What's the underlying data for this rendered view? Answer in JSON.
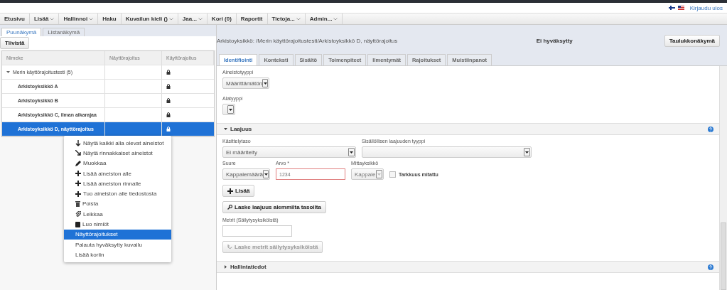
{
  "header": {
    "link": "Kirjaudu ulos"
  },
  "menu_bar": [
    {
      "label": "Etusivu",
      "dropdown": false
    },
    {
      "label": "Lisää",
      "dropdown": true
    },
    {
      "label": "Hallinnoi",
      "dropdown": true
    },
    {
      "label": "Haku",
      "dropdown": false
    },
    {
      "label": "Kuvailun kieli ()",
      "dropdown": true
    },
    {
      "label": "Jaa...",
      "dropdown": true
    },
    {
      "label": "Kori (0)",
      "dropdown": false
    },
    {
      "label": "Raportit",
      "dropdown": false
    },
    {
      "label": "Tietoja...",
      "dropdown": true
    },
    {
      "label": "Admin...",
      "dropdown": true
    }
  ],
  "left_tabs": [
    {
      "label": "Puunäkymä",
      "selected": true
    },
    {
      "label": "Listanäkymä",
      "selected": false
    }
  ],
  "collapse_button": "Tiivistä",
  "tree_table": {
    "columns": [
      "Nimeke",
      "Näyttörajoitus",
      "Käyttörajoitus"
    ],
    "rows": [
      {
        "name": "Merin käyttörajoitustesti (5)",
        "expanded": true,
        "locked": true,
        "selected": false,
        "children": [
          {
            "name": "Arkistoyksikkö A",
            "locked": true,
            "selected": false
          },
          {
            "name": "Arkistoyksikkö B",
            "locked": true,
            "selected": false
          },
          {
            "name": "Arkistoyksikkö C, ilman aikarajaa",
            "locked": true,
            "selected": false
          },
          {
            "name": "Arkistoyksikkö D, näyttörajoitus",
            "locked": true,
            "selected": true
          }
        ]
      }
    ]
  },
  "context_menu": [
    {
      "label": "Näytä kaikki alla olevat aineistot",
      "kind": "down",
      "selected": false
    },
    {
      "label": "Näytä rinnakkaiset aineistot",
      "kind": "diagonal",
      "selected": false
    },
    {
      "label": "Muokkaa",
      "kind": "edit",
      "selected": false
    },
    {
      "label": "Lisää aineiston alle",
      "kind": "add",
      "selected": false
    },
    {
      "label": "Lisää aineiston rinnalle",
      "kind": "add",
      "selected": false
    },
    {
      "label": "Tuo aineiston alle tiedostosta",
      "kind": "add",
      "selected": false
    },
    {
      "label": "Poista",
      "kind": "delete",
      "selected": false
    },
    {
      "label": "Leikkaa",
      "kind": "cut",
      "selected": false
    },
    {
      "label": "Luo nimiöt",
      "kind": "labels",
      "selected": false
    },
    {
      "label": "Näyttörajoitukset",
      "kind": "plain",
      "selected": true
    },
    {
      "label": "Palauta hyväksytty kuvailu",
      "kind": "plain",
      "selected": false
    },
    {
      "label": "Lisää koriin",
      "kind": "plain",
      "selected": false
    }
  ],
  "detail": {
    "breadcrumb": "Arkistoyksikkö: /Merin käyttörajoitustesti/Arkistoyksikkö D, näyttörajoitus",
    "status": "Ei hyväksytty",
    "view_button": "Taulukkonäkymä",
    "tabs": [
      {
        "label": "Identifiointi",
        "selected": true
      },
      {
        "label": "Konteksti",
        "selected": false
      },
      {
        "label": "Sisältö",
        "selected": false
      },
      {
        "label": "Toimenpiteet",
        "selected": false
      },
      {
        "label": "Ilmentymät",
        "selected": false
      },
      {
        "label": "Rajoitukset",
        "selected": false
      },
      {
        "label": "Muistiinpanot",
        "selected": false
      }
    ],
    "type_fields": [
      {
        "label": "Aineistotyyppi",
        "value": "Määrittämätön"
      },
      {
        "label": "Alatyyppi"
      }
    ],
    "sections": [
      {
        "title": "Laajuus",
        "expanded": true
      },
      {
        "title": "Hallintatiedot",
        "expanded": false
      }
    ],
    "laajuus": {
      "level": {
        "label": "Käsittelytaso",
        "value": "Ei määritelty"
      },
      "content_type": {
        "label": "Sisällöllisen laajuuden tyyppi"
      },
      "quantity": {
        "label": "Suure",
        "value": "Kappalemäärä"
      },
      "amount": {
        "label": "Arvo *",
        "placeholder": "1234",
        "invalid": true
      },
      "unit": {
        "label": "Mittayksikkö",
        "value": "Kappale",
        "disabled": true
      },
      "measured": {
        "label": "Tarkkuus mitattu",
        "checked": false
      },
      "add_button": "Lisää",
      "calc_button": "Laske laajuus alemmilta tasoilta",
      "meters": {
        "label": "Metrit (Säilytysyksiköistä)"
      },
      "meters_button": {
        "label": "Laske metrit säilytysyksiköistä",
        "disabled": true
      }
    }
  }
}
